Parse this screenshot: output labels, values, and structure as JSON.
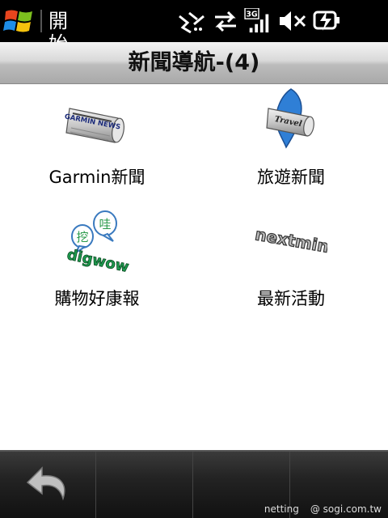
{
  "statusbar": {
    "start_label": "開始",
    "icons": [
      "windows-logo",
      "connectivity-icon",
      "sync-arrows-icon",
      "3g-signal-icon",
      "mute-speaker-icon",
      "battery-charging-icon"
    ],
    "signal_type": "3G"
  },
  "titlebar": {
    "title": "新聞導航-(4)"
  },
  "tiles": [
    {
      "label": "Garmin新聞",
      "icon": "garmin-news-icon",
      "logo_text": "GARMIN NEWS"
    },
    {
      "label": "旅遊新聞",
      "icon": "travel-news-icon",
      "logo_text": "Travel"
    },
    {
      "label": "購物好康報",
      "icon": "shopping-deals-icon",
      "logo_text": "digwow",
      "bubble_text_1": "挖",
      "bubble_text_2": "哇"
    },
    {
      "label": "最新活動",
      "icon": "latest-events-icon",
      "logo_text": "nextmin"
    }
  ],
  "bottombar": {
    "back_icon": "back-arrow-icon",
    "credit_left": "netting",
    "credit_right": "@ sogi.com.tw"
  }
}
